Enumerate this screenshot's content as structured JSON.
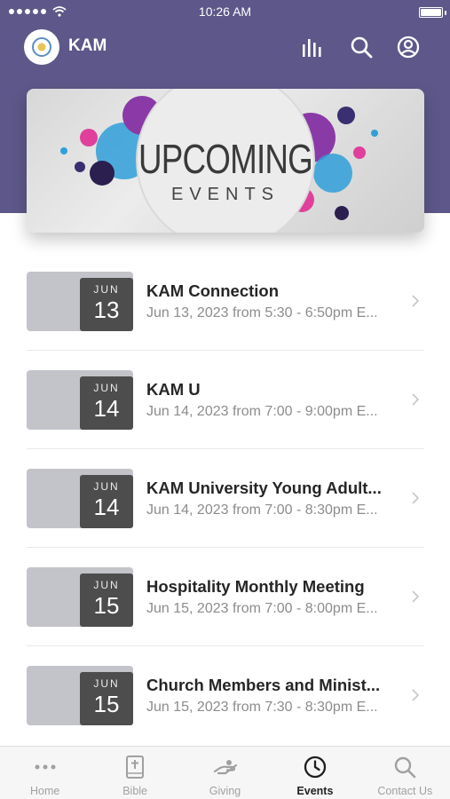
{
  "status_bar": {
    "time": "10:26 AM"
  },
  "nav": {
    "title": "KAM",
    "icons": [
      "logo-icon",
      "audio-bars-icon",
      "search-icon",
      "profile-icon"
    ]
  },
  "banner": {
    "title": "UPCOMING",
    "subtitle": "EVENTS"
  },
  "events": [
    {
      "month": "JUN",
      "day": "13",
      "title": "KAM Connection",
      "subtitle": "Jun 13, 2023 from 5:30 - 6:50pm E..."
    },
    {
      "month": "JUN",
      "day": "14",
      "title": "KAM U",
      "subtitle": "Jun 14, 2023 from 7:00 - 9:00pm E..."
    },
    {
      "month": "JUN",
      "day": "14",
      "title": "KAM University Young Adult...",
      "subtitle": "Jun 14, 2023 from 7:00 - 8:30pm E..."
    },
    {
      "month": "JUN",
      "day": "15",
      "title": "Hospitality Monthly Meeting",
      "subtitle": "Jun 15, 2023 from 7:00 - 8:00pm E..."
    },
    {
      "month": "JUN",
      "day": "15",
      "title": "Church Members and Minist...",
      "subtitle": "Jun 15, 2023 from 7:30 - 8:30pm E..."
    }
  ],
  "tabs": [
    {
      "label": "Home",
      "icon": "more-dots-icon",
      "active": false
    },
    {
      "label": "Bible",
      "icon": "bible-icon",
      "active": false
    },
    {
      "label": "Giving",
      "icon": "giving-hand-icon",
      "active": false
    },
    {
      "label": "Events",
      "icon": "clock-icon",
      "active": true
    },
    {
      "label": "Contact Us",
      "icon": "search-icon",
      "active": false
    }
  ],
  "colors": {
    "header": "#5d5889",
    "date_box": "#4d4d4d",
    "thumb": "#c3c4c9"
  }
}
